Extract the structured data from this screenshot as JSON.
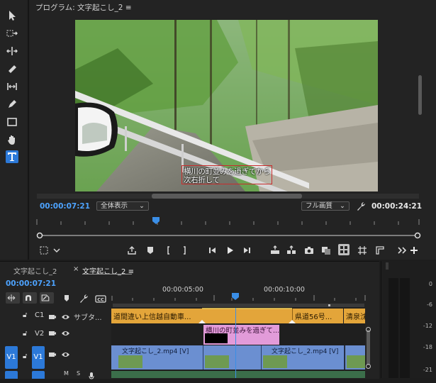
{
  "monitor": {
    "title": "プログラム: 文字起こし_2",
    "menu_glyph": "≡",
    "caption_line1": "横川の町並みを過ぎてから",
    "caption_line2": "次右折して",
    "current_timecode": "00:00:07:21",
    "fit_dropdown": "全体表示",
    "quality_dropdown": "フル画質",
    "duration_timecode": "00:00:24:21"
  },
  "timeline": {
    "tabs": [
      {
        "label": "文字起こし_2",
        "active": false
      },
      {
        "label": "文字起こし_2",
        "active": true
      }
    ],
    "close_glyph": "×",
    "menu_glyph": "≡",
    "current_timecode": "00:00:07:21",
    "ruler_labels": [
      "00:00:05:00",
      "00:00:10:00"
    ],
    "tracks": {
      "c1": {
        "name": "C1",
        "label": "サブタ..."
      },
      "v2": {
        "name": "V2"
      },
      "v1": {
        "source": "V1",
        "name": "V1"
      },
      "a1": {
        "m": "M",
        "s": "S"
      }
    },
    "caption_clips": [
      "道間違い上信越自動車...",
      "県道56号...",
      "清泉沈"
    ],
    "v2_clip": "横川の町並みを過ぎて...",
    "v1_clips": [
      "文字起こし_2.mp4 [V]",
      "文字起こし_2.mp4 [V]"
    ]
  },
  "meter": {
    "labels": [
      "0",
      "-6",
      "-12",
      "-18",
      "-21"
    ]
  },
  "colors": {
    "accent": "#2c79d8",
    "timecode": "#4da3ff",
    "caption_clip": "#e3a53a",
    "graphic_clip": "#e29bd9",
    "video_clip": "#6b8fd1",
    "playhead": "#3a8ee6"
  }
}
